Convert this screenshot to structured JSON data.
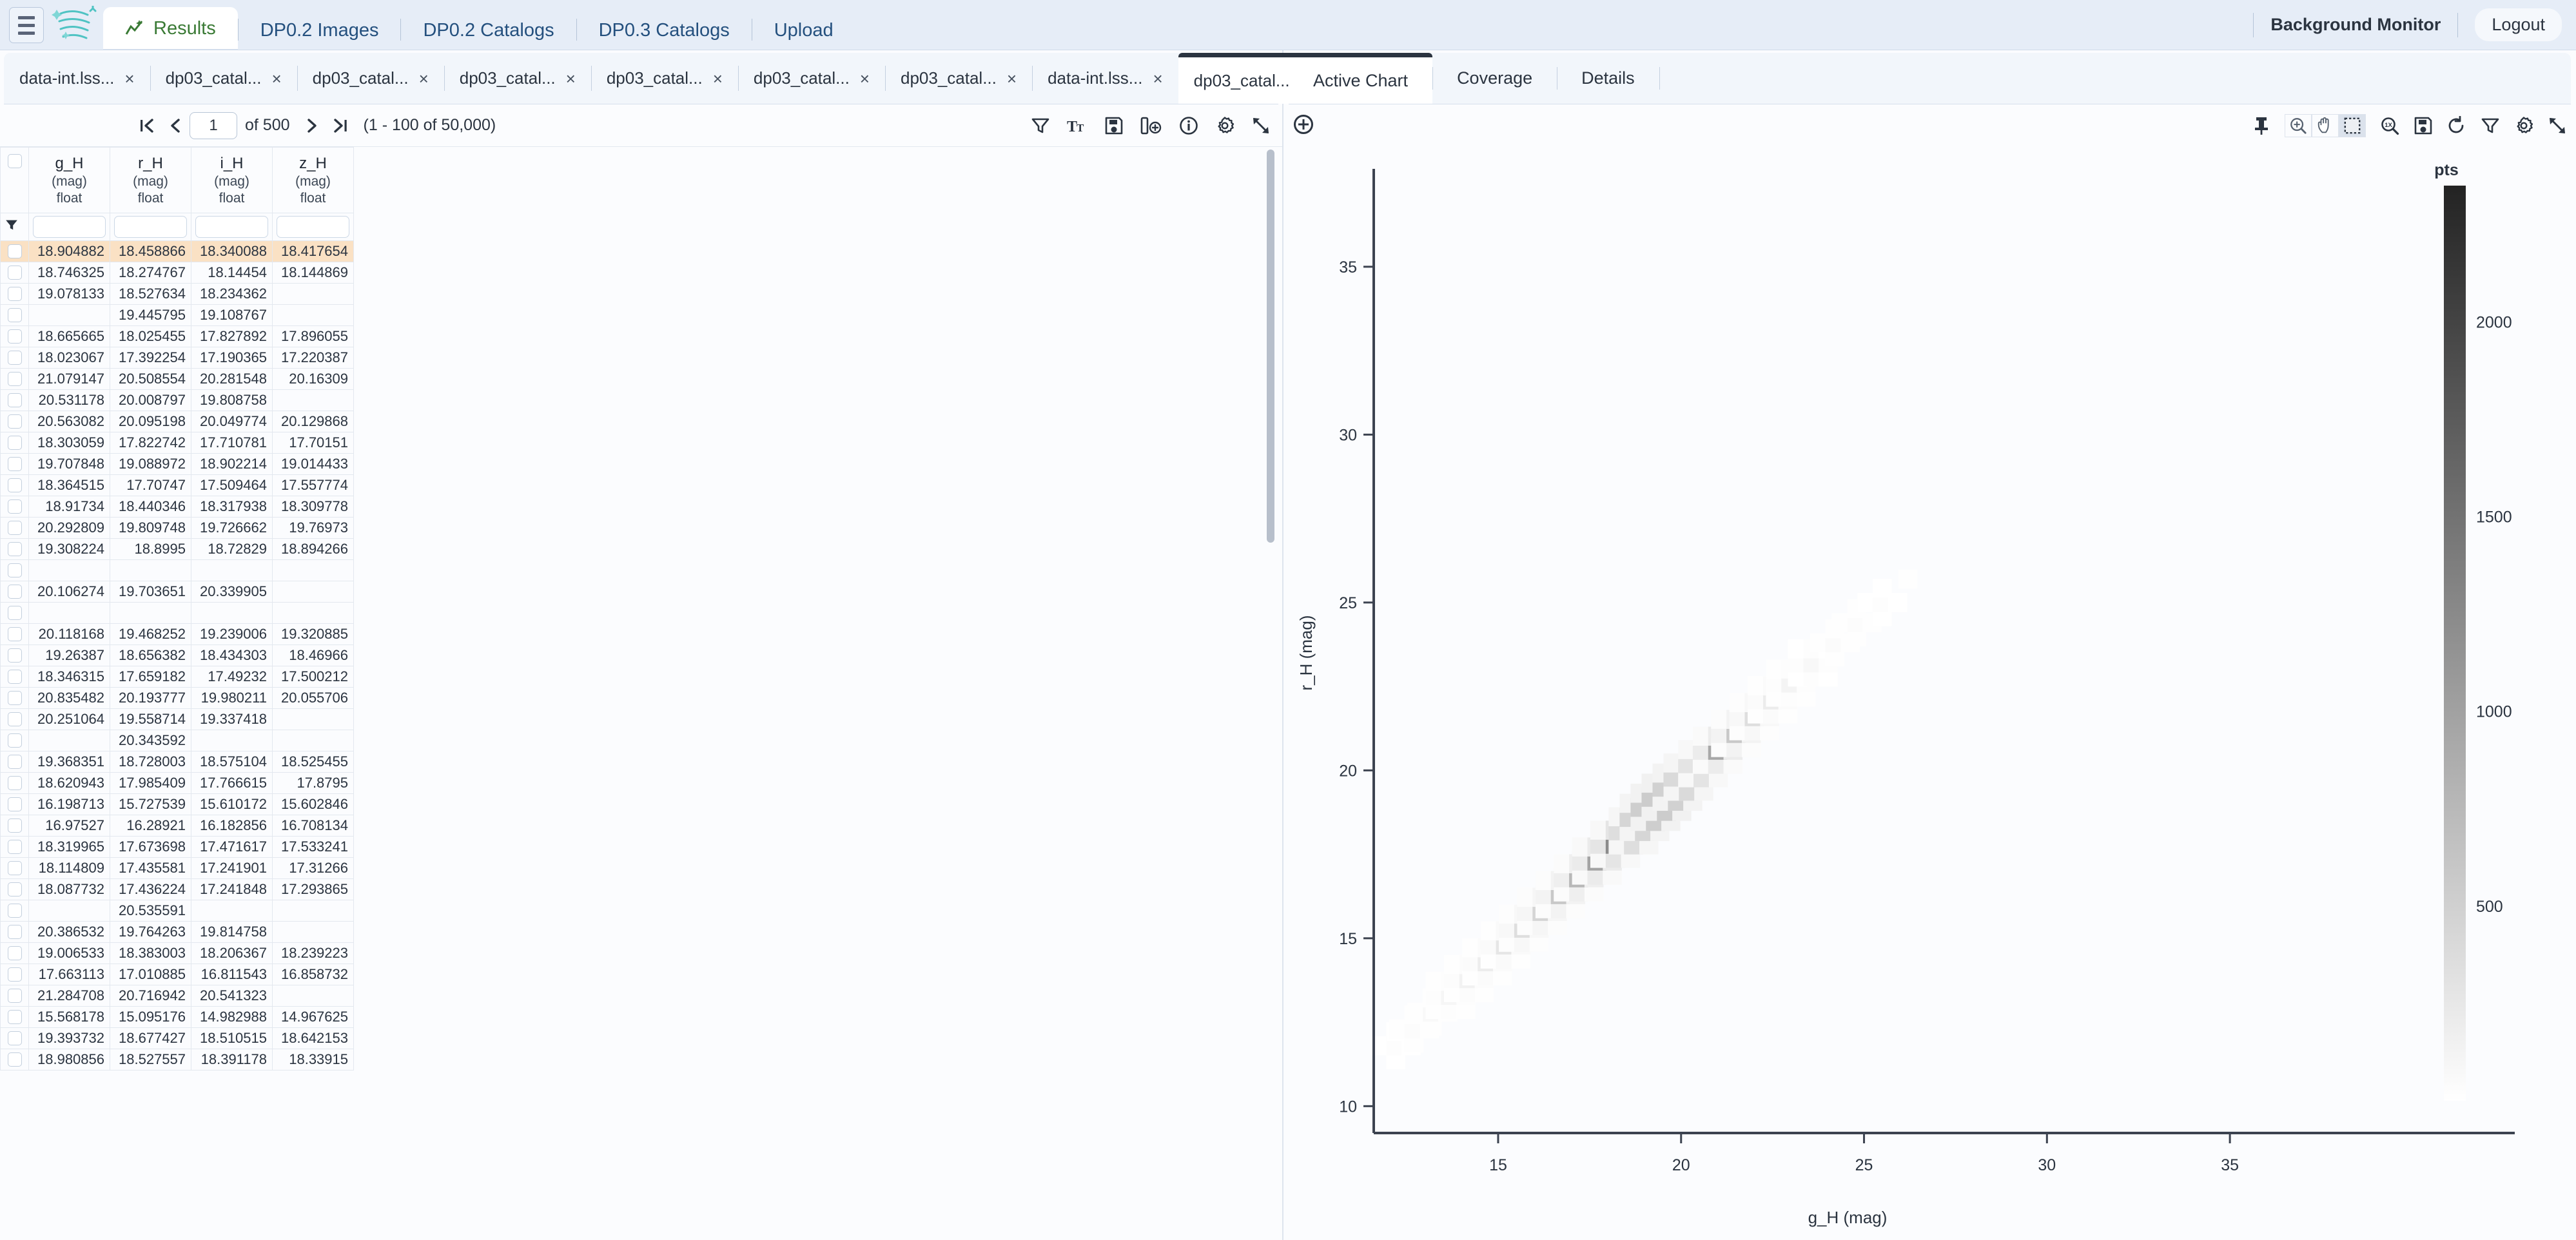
{
  "header": {
    "menu_icon": "hamburger-icon",
    "logo_icon": "rubin-logo-icon",
    "nav": [
      {
        "label": "Results",
        "icon": "results-chart-icon",
        "active": true
      },
      {
        "label": "DP0.2 Images",
        "active": false
      },
      {
        "label": "DP0.2 Catalogs",
        "active": false
      },
      {
        "label": "DP0.3 Catalogs",
        "active": false
      },
      {
        "label": "Upload",
        "active": false
      }
    ],
    "background_monitor": "Background Monitor",
    "logout": "Logout"
  },
  "result_tabs": {
    "items": [
      {
        "label": "data-int.lss...",
        "close": "×",
        "active": false
      },
      {
        "label": "dp03_catal...",
        "close": "×",
        "active": false
      },
      {
        "label": "dp03_catal...",
        "close": "×",
        "active": false
      },
      {
        "label": "dp03_catal...",
        "close": "×",
        "active": false
      },
      {
        "label": "dp03_catal...",
        "close": "×",
        "active": false
      },
      {
        "label": "dp03_catal...",
        "close": "×",
        "active": false
      },
      {
        "label": "dp03_catal...",
        "close": "×",
        "active": false
      },
      {
        "label": "data-int.lss...",
        "close": "×",
        "active": false
      },
      {
        "label": "dp03_catal...",
        "close": "×",
        "active": true
      }
    ],
    "overflow_icon": "▼"
  },
  "table_toolbar": {
    "first_page_icon": "first-page-icon",
    "prev_page_icon": "prev-page-icon",
    "page_value": "1",
    "page_of": "of 500",
    "next_page_icon": "next-page-icon",
    "last_page_icon": "last-page-icon",
    "row_range": "(1 - 100 of 50,000)",
    "icons": [
      {
        "name": "filter-icon",
        "title": "Filter"
      },
      {
        "name": "text-size-icon",
        "title": "Text size"
      },
      {
        "name": "save-icon",
        "title": "Save"
      },
      {
        "name": "add-column-icon",
        "title": "Add column"
      },
      {
        "name": "info-icon",
        "title": "Info"
      },
      {
        "name": "settings-icon",
        "title": "Settings"
      },
      {
        "name": "expand-icon",
        "title": "Expand"
      }
    ]
  },
  "table": {
    "filter_row_icon": "filter-icon",
    "columns": [
      {
        "name": "g_H",
        "unit": "(mag)",
        "type": "float"
      },
      {
        "name": "r_H",
        "unit": "(mag)",
        "type": "float"
      },
      {
        "name": "i_H",
        "unit": "(mag)",
        "type": "float"
      },
      {
        "name": "z_H",
        "unit": "(mag)",
        "type": "float"
      }
    ],
    "rows": [
      {
        "selected": true,
        "cells": [
          "18.904882",
          "18.458866",
          "18.340088",
          "18.417654"
        ]
      },
      {
        "selected": false,
        "cells": [
          "18.746325",
          "18.274767",
          "18.14454",
          "18.144869"
        ]
      },
      {
        "selected": false,
        "cells": [
          "19.078133",
          "18.527634",
          "18.234362",
          ""
        ]
      },
      {
        "selected": false,
        "cells": [
          "",
          "19.445795",
          "19.108767",
          ""
        ]
      },
      {
        "selected": false,
        "cells": [
          "18.665665",
          "18.025455",
          "17.827892",
          "17.896055"
        ]
      },
      {
        "selected": false,
        "cells": [
          "18.023067",
          "17.392254",
          "17.190365",
          "17.220387"
        ]
      },
      {
        "selected": false,
        "cells": [
          "21.079147",
          "20.508554",
          "20.281548",
          "20.16309"
        ]
      },
      {
        "selected": false,
        "cells": [
          "20.531178",
          "20.008797",
          "19.808758",
          ""
        ]
      },
      {
        "selected": false,
        "cells": [
          "20.563082",
          "20.095198",
          "20.049774",
          "20.129868"
        ]
      },
      {
        "selected": false,
        "cells": [
          "18.303059",
          "17.822742",
          "17.710781",
          "17.70151"
        ]
      },
      {
        "selected": false,
        "cells": [
          "19.707848",
          "19.088972",
          "18.902214",
          "19.014433"
        ]
      },
      {
        "selected": false,
        "cells": [
          "18.364515",
          "17.70747",
          "17.509464",
          "17.557774"
        ]
      },
      {
        "selected": false,
        "cells": [
          "18.91734",
          "18.440346",
          "18.317938",
          "18.309778"
        ]
      },
      {
        "selected": false,
        "cells": [
          "20.292809",
          "19.809748",
          "19.726662",
          "19.76973"
        ]
      },
      {
        "selected": false,
        "cells": [
          "19.308224",
          "18.8995",
          "18.72829",
          "18.894266"
        ]
      },
      {
        "selected": false,
        "cells": [
          "",
          "",
          "",
          ""
        ]
      },
      {
        "selected": false,
        "cells": [
          "20.106274",
          "19.703651",
          "20.339905",
          ""
        ]
      },
      {
        "selected": false,
        "cells": [
          "",
          "",
          "",
          ""
        ]
      },
      {
        "selected": false,
        "cells": [
          "20.118168",
          "19.468252",
          "19.239006",
          "19.320885"
        ]
      },
      {
        "selected": false,
        "cells": [
          "19.26387",
          "18.656382",
          "18.434303",
          "18.46966"
        ]
      },
      {
        "selected": false,
        "cells": [
          "18.346315",
          "17.659182",
          "17.49232",
          "17.500212"
        ]
      },
      {
        "selected": false,
        "cells": [
          "20.835482",
          "20.193777",
          "19.980211",
          "20.055706"
        ]
      },
      {
        "selected": false,
        "cells": [
          "20.251064",
          "19.558714",
          "19.337418",
          ""
        ]
      },
      {
        "selected": false,
        "cells": [
          "",
          "20.343592",
          "",
          ""
        ]
      },
      {
        "selected": false,
        "cells": [
          "19.368351",
          "18.728003",
          "18.575104",
          "18.525455"
        ]
      },
      {
        "selected": false,
        "cells": [
          "18.620943",
          "17.985409",
          "17.766615",
          "17.8795"
        ]
      },
      {
        "selected": false,
        "cells": [
          "16.198713",
          "15.727539",
          "15.610172",
          "15.602846"
        ]
      },
      {
        "selected": false,
        "cells": [
          "16.97527",
          "16.28921",
          "16.182856",
          "16.708134"
        ]
      },
      {
        "selected": false,
        "cells": [
          "18.319965",
          "17.673698",
          "17.471617",
          "17.533241"
        ]
      },
      {
        "selected": false,
        "cells": [
          "18.114809",
          "17.435581",
          "17.241901",
          "17.31266"
        ]
      },
      {
        "selected": false,
        "cells": [
          "18.087732",
          "17.436224",
          "17.241848",
          "17.293865"
        ]
      },
      {
        "selected": false,
        "cells": [
          "",
          "20.535591",
          "",
          ""
        ]
      },
      {
        "selected": false,
        "cells": [
          "20.386532",
          "19.764263",
          "19.814758",
          ""
        ]
      },
      {
        "selected": false,
        "cells": [
          "19.006533",
          "18.383003",
          "18.206367",
          "18.239223"
        ]
      },
      {
        "selected": false,
        "cells": [
          "17.663113",
          "17.010885",
          "16.811543",
          "16.858732"
        ]
      },
      {
        "selected": false,
        "cells": [
          "21.284708",
          "20.716942",
          "20.541323",
          ""
        ]
      },
      {
        "selected": false,
        "cells": [
          "15.568178",
          "15.095176",
          "14.982988",
          "14.967625"
        ]
      },
      {
        "selected": false,
        "cells": [
          "19.393732",
          "18.677427",
          "18.510515",
          "18.642153"
        ]
      },
      {
        "selected": false,
        "cells": [
          "18.980856",
          "18.527557",
          "18.391178",
          "18.33915"
        ]
      }
    ]
  },
  "chart_panel": {
    "add_chart_icon": "add-chart-icon",
    "tabs": [
      {
        "label": "Active Chart",
        "active": true
      },
      {
        "label": "Coverage",
        "active": false
      },
      {
        "label": "Details",
        "active": false
      }
    ],
    "toolbar_icons": [
      {
        "name": "pin-icon",
        "active": false,
        "grouped": false
      },
      {
        "name": "zoom-in-icon",
        "active": false,
        "grouped": true
      },
      {
        "name": "pan-icon",
        "active": false,
        "grouped": true
      },
      {
        "name": "select-box-icon",
        "active": true,
        "grouped": true
      },
      {
        "name": "zoom-reset-1x-icon",
        "active": false,
        "grouped": false
      },
      {
        "name": "save-icon",
        "active": false,
        "grouped": false
      },
      {
        "name": "refresh-icon",
        "active": false,
        "grouped": false
      },
      {
        "name": "filter-icon",
        "active": false,
        "grouped": false
      },
      {
        "name": "settings-icon",
        "active": false,
        "grouped": false
      },
      {
        "name": "expand-icon",
        "active": false,
        "grouped": false
      }
    ]
  },
  "chart_data": {
    "type": "heatmap",
    "title": "",
    "xlabel": "g_H (mag)",
    "ylabel": "r_H (mag)",
    "xlim": [
      11.6,
      37.5
    ],
    "ylim": [
      9.2,
      37.8
    ],
    "xticks": [
      15,
      20,
      25,
      30,
      35
    ],
    "yticks": [
      10,
      15,
      20,
      25,
      30,
      35
    ],
    "grid": false,
    "colorbar": {
      "label": "pts",
      "ticks": [
        500,
        1000,
        1500,
        2000
      ],
      "min": 0,
      "max": 2350,
      "colormap": "grayscale-light-to-dark",
      "low_color": "#ffffff",
      "high_color": "#232323",
      "position": "right"
    },
    "description": "2D density histogram of r_H vs g_H magnitude; points lie along a tight near-unity diagonal ridge with the darkest (highest count) bins near g_H ~19-20.",
    "bins": [
      {
        "x": 12.2,
        "y": 11.8,
        "count": 20
      },
      {
        "x": 12.7,
        "y": 12.3,
        "count": 35
      },
      {
        "x": 13.2,
        "y": 12.8,
        "count": 60
      },
      {
        "x": 13.7,
        "y": 13.3,
        "count": 95
      },
      {
        "x": 14.2,
        "y": 13.8,
        "count": 130
      },
      {
        "x": 14.7,
        "y": 14.3,
        "count": 185
      },
      {
        "x": 15.2,
        "y": 14.8,
        "count": 250
      },
      {
        "x": 15.7,
        "y": 15.3,
        "count": 330
      },
      {
        "x": 16.2,
        "y": 15.8,
        "count": 430
      },
      {
        "x": 16.7,
        "y": 16.3,
        "count": 560
      },
      {
        "x": 17.2,
        "y": 16.8,
        "count": 720
      },
      {
        "x": 17.7,
        "y": 17.3,
        "count": 930
      },
      {
        "x": 18.2,
        "y": 17.8,
        "count": 1180
      },
      {
        "x": 18.7,
        "y": 18.2,
        "count": 1520
      },
      {
        "x": 19.0,
        "y": 18.6,
        "count": 1900
      },
      {
        "x": 19.3,
        "y": 18.9,
        "count": 2250
      },
      {
        "x": 19.6,
        "y": 19.2,
        "count": 2350
      },
      {
        "x": 19.9,
        "y": 19.5,
        "count": 2100
      },
      {
        "x": 20.2,
        "y": 19.8,
        "count": 1700
      },
      {
        "x": 20.6,
        "y": 20.2,
        "count": 1250
      },
      {
        "x": 21.0,
        "y": 20.6,
        "count": 880
      },
      {
        "x": 21.5,
        "y": 21.1,
        "count": 560
      },
      {
        "x": 22.0,
        "y": 21.6,
        "count": 330
      },
      {
        "x": 22.5,
        "y": 22.1,
        "count": 190
      },
      {
        "x": 23.0,
        "y": 22.6,
        "count": 110
      },
      {
        "x": 23.6,
        "y": 23.2,
        "count": 70
      },
      {
        "x": 24.2,
        "y": 23.8,
        "count": 45
      },
      {
        "x": 24.8,
        "y": 24.4,
        "count": 30
      },
      {
        "x": 25.5,
        "y": 25.0,
        "count": 20
      },
      {
        "x": 26.2,
        "y": 25.7,
        "count": 14
      }
    ]
  }
}
